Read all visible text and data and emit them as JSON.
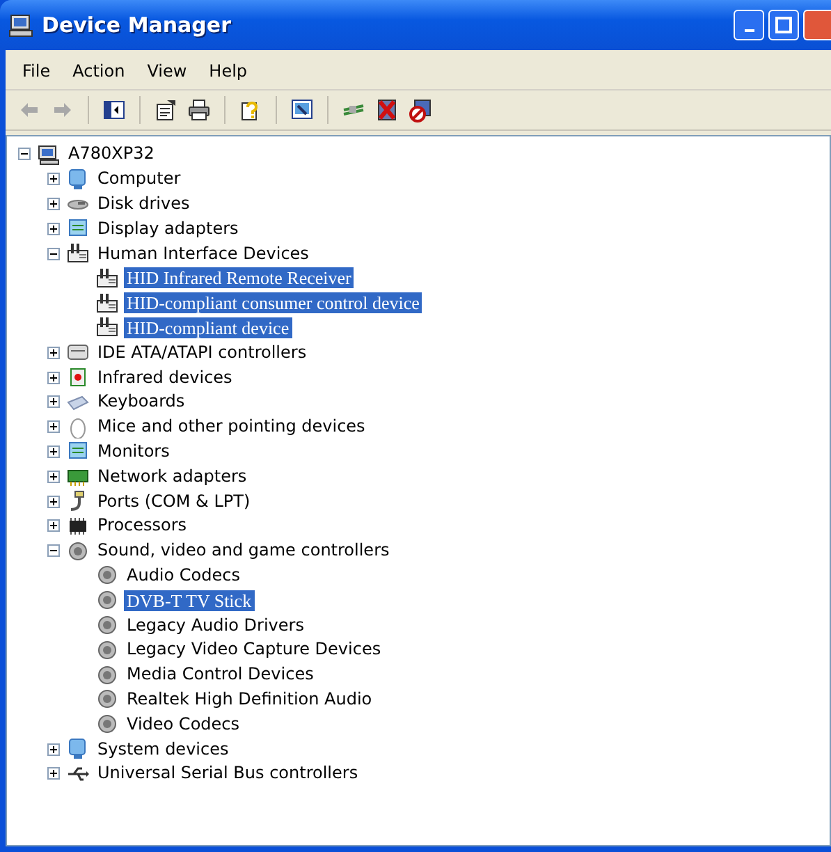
{
  "window": {
    "title": "Device Manager"
  },
  "menu": [
    "File",
    "Action",
    "View",
    "Help"
  ],
  "toolbar": [
    {
      "disabled": true
    },
    {
      "disabled": true
    },
    {
      "disabled": false
    },
    {
      "disabled": false
    },
    {
      "disabled": false
    },
    {
      "disabled": false
    },
    {
      "disabled": false
    },
    {
      "disabled": false
    },
    {
      "disabled": false
    },
    {
      "disabled": false
    }
  ],
  "tree": [
    {
      "label": "A780XP32",
      "expanded": true,
      "selected": false,
      "children": [
        {
          "label": "Computer",
          "expanded": false,
          "selected": false
        },
        {
          "label": "Disk drives",
          "expanded": false,
          "selected": false
        },
        {
          "label": "Display adapters",
          "expanded": false,
          "selected": false
        },
        {
          "label": "Human Interface Devices",
          "expanded": true,
          "selected": false,
          "children": [
            {
              "label": "HID Infrared Remote Receiver",
              "selected": true
            },
            {
              "label": "HID-compliant consumer control device",
              "selected": true
            },
            {
              "label": "HID-compliant device",
              "selected": true
            }
          ]
        },
        {
          "label": "IDE ATA/ATAPI controllers",
          "expanded": false,
          "selected": false
        },
        {
          "label": "Infrared devices",
          "expanded": false,
          "selected": false
        },
        {
          "label": "Keyboards",
          "expanded": false,
          "selected": false
        },
        {
          "label": "Mice and other pointing devices",
          "expanded": false,
          "selected": false
        },
        {
          "label": "Monitors",
          "expanded": false,
          "selected": false
        },
        {
          "label": "Network adapters",
          "expanded": false,
          "selected": false
        },
        {
          "label": "Ports (COM & LPT)",
          "expanded": false,
          "selected": false
        },
        {
          "label": "Processors",
          "expanded": false,
          "selected": false
        },
        {
          "label": "Sound, video and game controllers",
          "expanded": true,
          "selected": false,
          "children": [
            {
              "label": "Audio Codecs",
              "selected": false
            },
            {
              "label": "DVB-T TV Stick",
              "selected": true
            },
            {
              "label": "Legacy Audio Drivers",
              "selected": false
            },
            {
              "label": "Legacy Video Capture Devices",
              "selected": false
            },
            {
              "label": "Media Control Devices",
              "selected": false
            },
            {
              "label": "Realtek High Definition Audio",
              "selected": false
            },
            {
              "label": "Video Codecs",
              "selected": false
            }
          ]
        },
        {
          "label": "System devices",
          "expanded": false,
          "selected": false
        },
        {
          "label": "Universal Serial Bus controllers",
          "expanded": false,
          "selected": false
        }
      ]
    }
  ]
}
